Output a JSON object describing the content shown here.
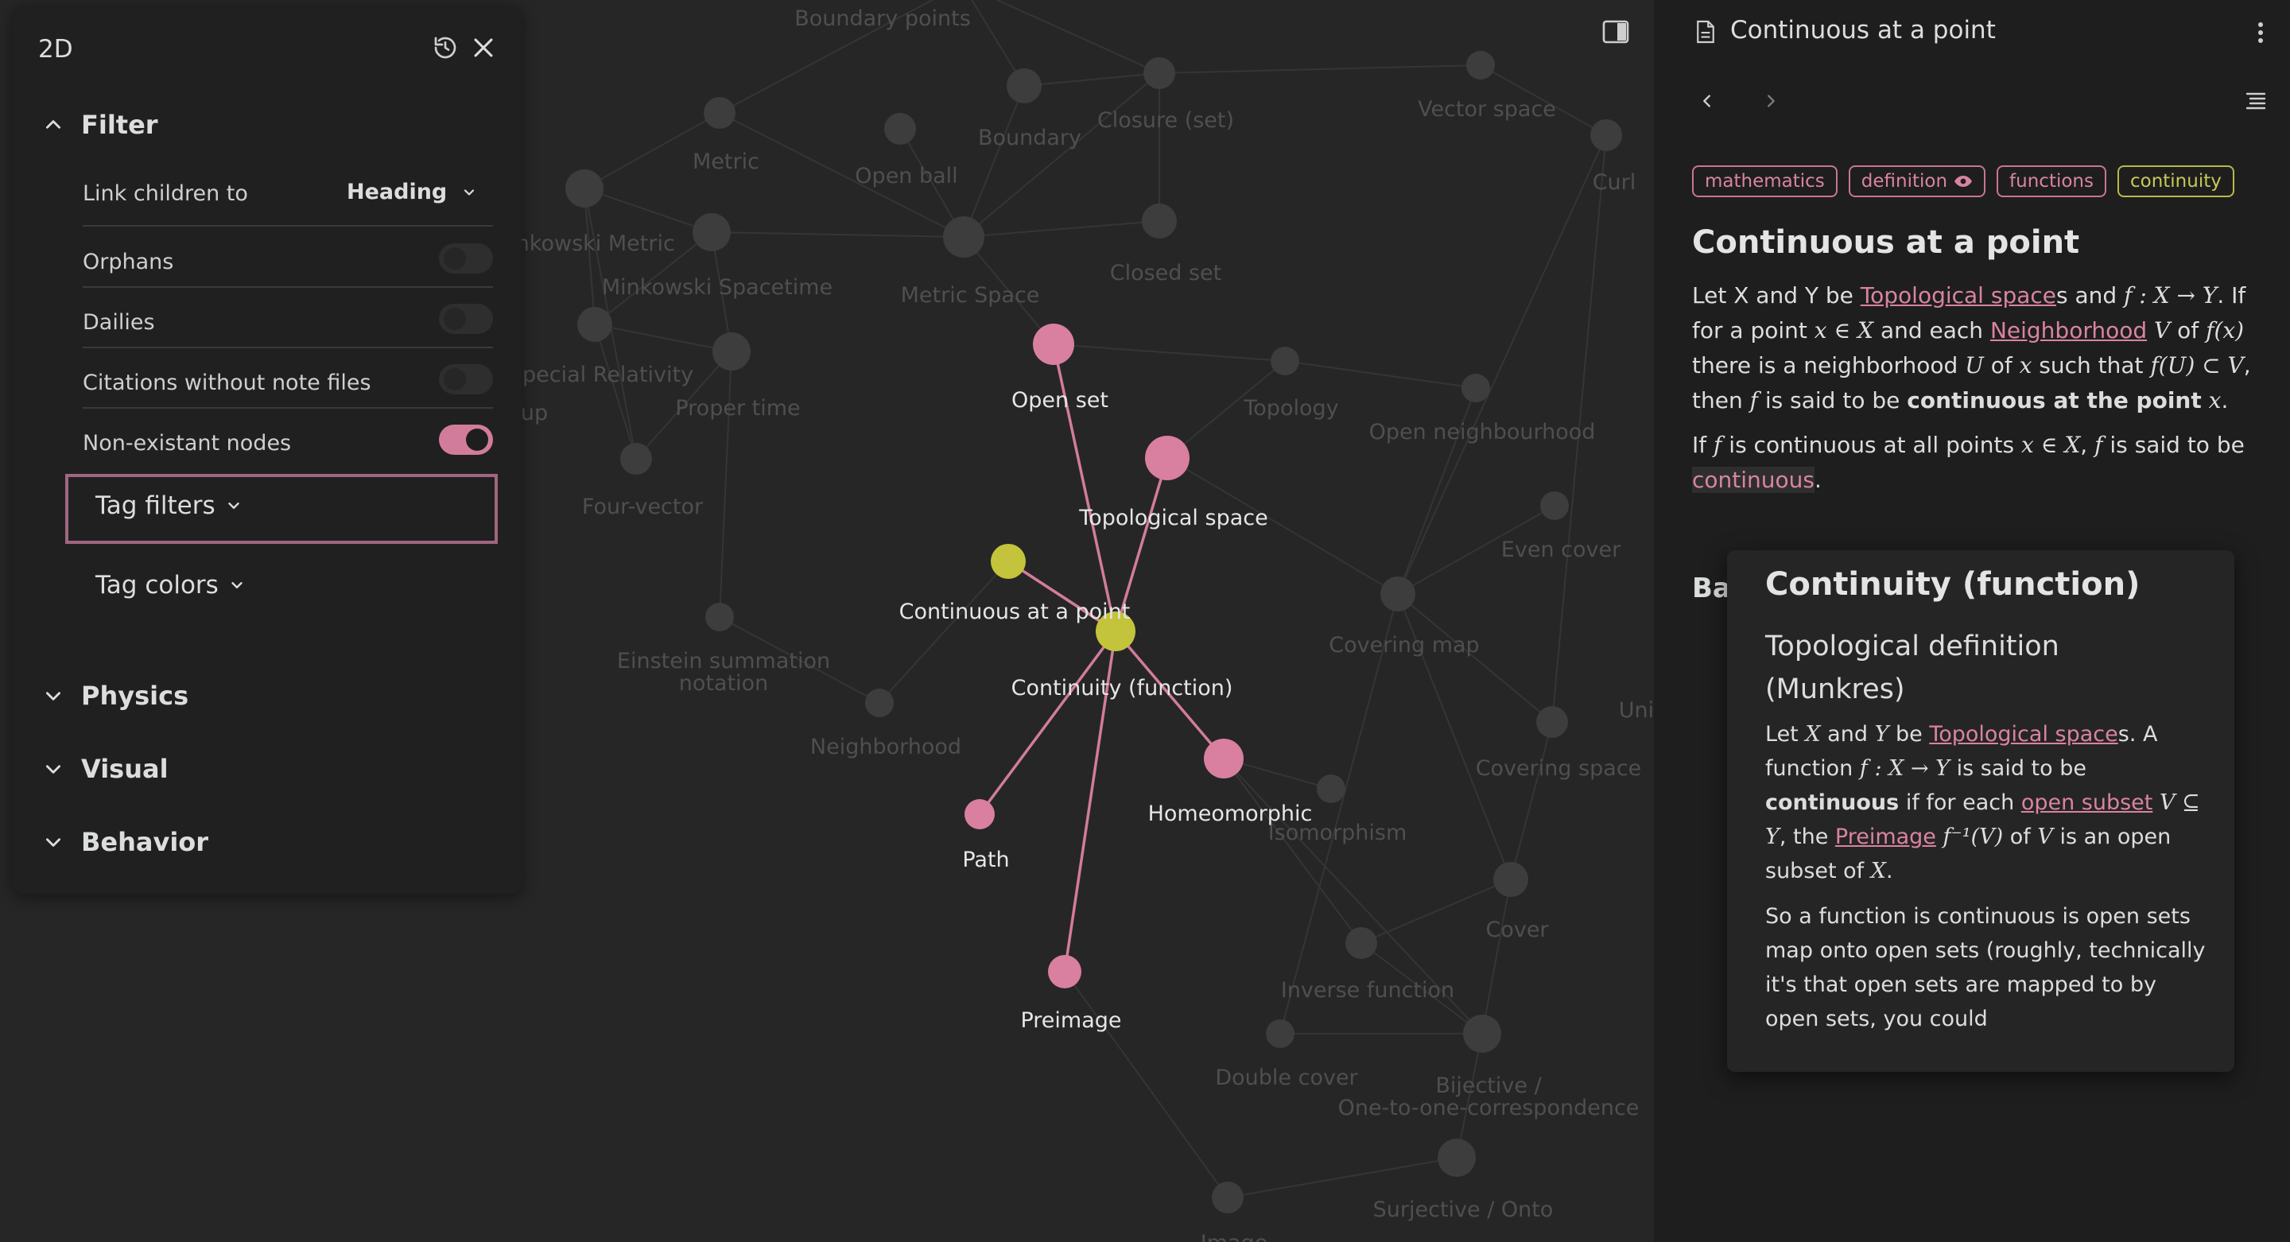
{
  "graph": {
    "nodes": [
      {
        "id": "boundary-points",
        "label": "Boundary points",
        "active": false
      },
      {
        "id": "metric",
        "label": "Metric",
        "active": false
      },
      {
        "id": "open-ball",
        "label": "Open ball",
        "active": false
      },
      {
        "id": "boundary",
        "label": "Boundary",
        "active": false
      },
      {
        "id": "closure-set",
        "label": "Closure (set)",
        "active": false
      },
      {
        "id": "vector-space",
        "label": "Vector space",
        "active": false
      },
      {
        "id": "curl",
        "label": "Curl",
        "active": false
      },
      {
        "id": "minkowski-metric",
        "label": "inkowski Metric",
        "active": false
      },
      {
        "id": "minkowski-spacetime",
        "label": "Minkowski Spacetime",
        "active": false
      },
      {
        "id": "metric-space",
        "label": "Metric Space",
        "active": false
      },
      {
        "id": "closed-set",
        "label": "Closed set",
        "active": false
      },
      {
        "id": "special-relativity",
        "label": "Special Relativity",
        "active": false
      },
      {
        "id": "up",
        "label": "up",
        "active": false
      },
      {
        "id": "proper-time",
        "label": "Proper time",
        "active": false
      },
      {
        "id": "topology",
        "label": "Topology",
        "active": false
      },
      {
        "id": "open-neighbourhood",
        "label": "Open neighbourhood",
        "active": false
      },
      {
        "id": "four-vector",
        "label": "Four-vector",
        "active": false
      },
      {
        "id": "even-cover",
        "label": "Even cover",
        "active": false
      },
      {
        "id": "covering-map",
        "label": "Covering map",
        "active": false
      },
      {
        "id": "einstein-summation",
        "label": "Einstein summation",
        "label2": "notation",
        "active": false
      },
      {
        "id": "neighborhood",
        "label": "Neighborhood",
        "active": false
      },
      {
        "id": "covering-space",
        "label": "Covering space",
        "active": false
      },
      {
        "id": "uni",
        "label": "Uni",
        "active": false
      },
      {
        "id": "isomorphism",
        "label": "Isomorphism",
        "active": false
      },
      {
        "id": "cover",
        "label": "Cover",
        "active": false
      },
      {
        "id": "inverse-function",
        "label": "Inverse function",
        "active": false
      },
      {
        "id": "double-cover",
        "label": "Double cover",
        "active": false
      },
      {
        "id": "bijective",
        "label": "Bijective /",
        "label2": "One-to-one-correspondence",
        "active": false
      },
      {
        "id": "surjective",
        "label": "Surjective / Onto",
        "active": false
      },
      {
        "id": "image",
        "label": "Image",
        "active": false
      },
      {
        "id": "open-set",
        "label": "Open set",
        "active": true
      },
      {
        "id": "topological-space",
        "label": "Topological space",
        "active": true
      },
      {
        "id": "continuous-at-a-point",
        "label": "Continuous at a point",
        "active": true
      },
      {
        "id": "continuity-function",
        "label": "Continuity (function)",
        "active": true
      },
      {
        "id": "homeomorphic",
        "label": "Homeomorphic",
        "active": true
      },
      {
        "id": "path",
        "label": "Path",
        "active": true
      },
      {
        "id": "preimage",
        "label": "Preimage",
        "active": true
      }
    ],
    "colors": {
      "faded_node": "#3d3d3d",
      "faded_edge": "#353535",
      "active_node": "#d97fa0",
      "tag_node": "#c4c43c",
      "active_edge": "#d27c9b"
    }
  },
  "settings": {
    "title": "2D",
    "filter": {
      "label": "Filter",
      "link_children_label": "Link children to",
      "link_children_value": "Heading",
      "orphans": "Orphans",
      "dailies": "Dailies",
      "citations": "Citations without note files",
      "non_existant": "Non-existant nodes",
      "non_existant_on": true,
      "tag_filters": "Tag filters",
      "tag_colors": "Tag colors"
    },
    "physics": "Physics",
    "visual": "Visual",
    "behavior": "Behavior"
  },
  "note": {
    "title": "Continuous at a point",
    "tags": [
      "mathematics",
      "definition",
      "functions",
      "continuity"
    ],
    "heading": "Continuous at a point",
    "p1": {
      "a": "Let X and Y be ",
      "link1": "Topological space",
      "b": "s and ",
      "m1": "f : X → Y",
      "c": ". If for a point ",
      "m2": "x ∈ X",
      "d": " and each ",
      "link2": "Neighborhood",
      "e": " ",
      "m3": "V",
      "f": " of ",
      "m4": "f(x)",
      "g": " there is a neighborhood ",
      "m5": "U",
      "h": " of ",
      "m6": "x",
      "i": " such that ",
      "m7": "f(U) ⊂ V",
      "j": ", then ",
      "m8": "f",
      "k": " is said to be ",
      "bold": "continuous at the point",
      "l": " ",
      "m9": "x",
      "end": "."
    },
    "p2": {
      "a": "If ",
      "m1": "f",
      "b": " is continuous at all points ",
      "m2": "x ∈ X",
      "c": ", ",
      "m3": "f",
      "d": " is said to be ",
      "link": "continuous",
      "end": "."
    },
    "h2_partial": "Ba"
  },
  "popover": {
    "title": "Continuity (function)",
    "subtitle": "Topological definition (Munkres)",
    "p1": {
      "a": "Let ",
      "m1": "X",
      "b": " and ",
      "m2": "Y",
      "c": " be ",
      "link1": "Topological space",
      "d": "s. A function ",
      "m3": "f : X → Y",
      "e": " is said to be ",
      "bold": "continuous",
      "f": " if for each ",
      "link2": "open subset",
      "g": " ",
      "m4": "V ⊆ Y",
      "h": ", the ",
      "link3": "Preimage",
      "i": " ",
      "m5": "f⁻¹(V)",
      "j": " of ",
      "m6": "V",
      "k": " is an open subset of ",
      "m7": "X",
      "end": "."
    },
    "p2": "So a function is continuous is open sets map onto open sets (roughly, technically it's that open sets are mapped to by open sets, you could"
  }
}
